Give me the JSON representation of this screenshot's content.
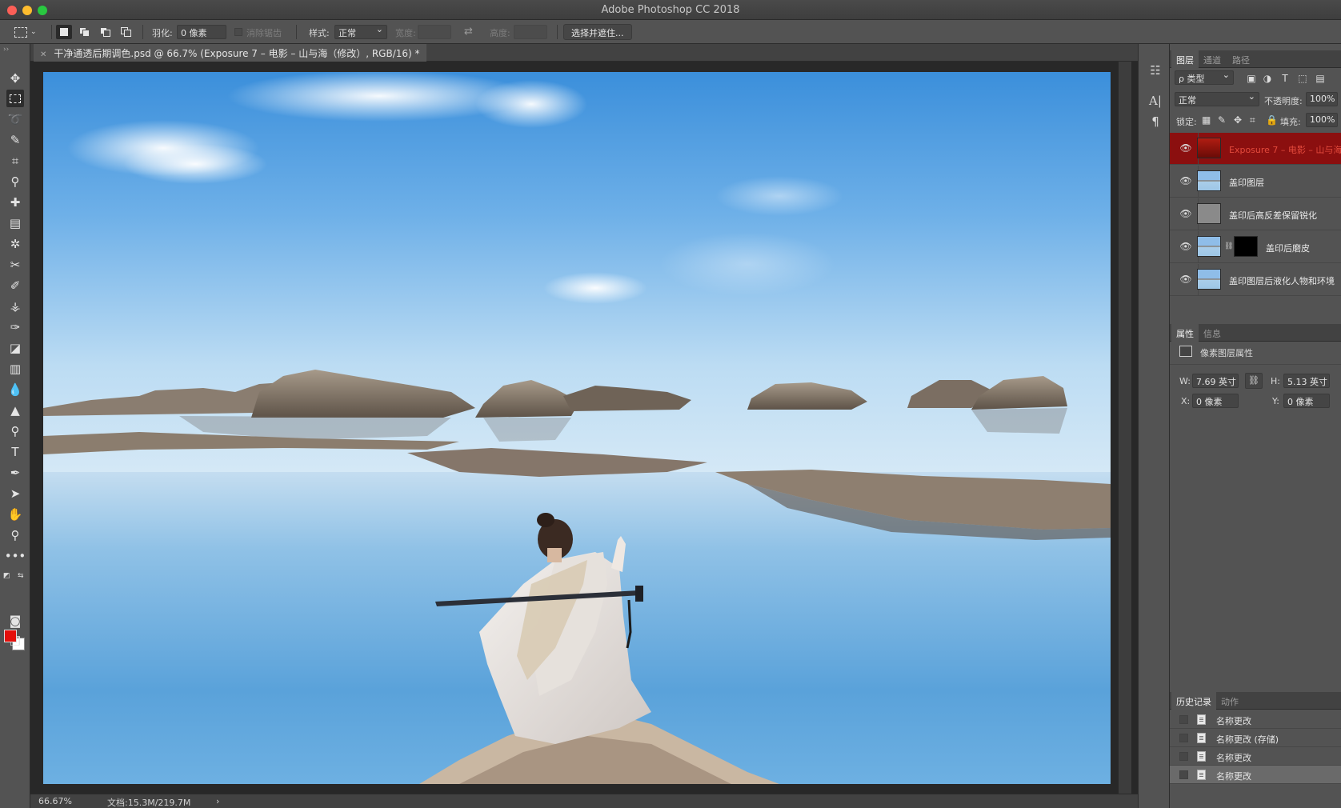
{
  "window": {
    "title": "Adobe Photoshop CC 2018"
  },
  "options_bar": {
    "feather_label": "羽化:",
    "feather_value": "0 像素",
    "antialias_label": "消除锯齿",
    "style_label": "样式:",
    "style_value": "正常",
    "width_label": "宽度:",
    "height_label": "高度:",
    "select_mask_button": "选择并遮住..."
  },
  "document": {
    "tab_title": "干净通透后期调色.psd @ 66.7% (Exposure 7 – 电影 – 山与海（修改）, RGB/16) *",
    "zoom": "66.67%",
    "doc_size": "文档:15.3M/219.7M"
  },
  "tools": {
    "foreground_color": "#e40f0b",
    "background_color": "#ffffff"
  },
  "layers_panel": {
    "tabs": [
      "图层",
      "通道",
      "路径"
    ],
    "filter_kind": "ρ 类型",
    "blend_mode": "正常",
    "opacity_label": "不透明度:",
    "opacity_value": "100%",
    "lock_label": "锁定:",
    "fill_label": "填充:",
    "fill_value": "100%",
    "layers": [
      {
        "name": "Exposure 7 – 电影 – 山与海",
        "selected": true
      },
      {
        "name": "盖印图层",
        "selected": false
      },
      {
        "name": "盖印后高反差保留锐化",
        "selected": false
      },
      {
        "name": "盖印后磨皮",
        "selected": false
      },
      {
        "name": "盖印图层后液化人物和环境",
        "selected": false
      }
    ]
  },
  "properties_panel": {
    "tabs": [
      "属性",
      "信息"
    ],
    "heading": "像素图层属性",
    "w_label": "W:",
    "w_value": "7.69 英寸",
    "h_label": "H:",
    "h_value": "5.13 英寸",
    "x_label": "X:",
    "x_value": "0 像素",
    "y_label": "Y:",
    "y_value": "0 像素"
  },
  "history_panel": {
    "tabs": [
      "历史记录",
      "动作"
    ],
    "items": [
      {
        "name": "名称更改",
        "current": false
      },
      {
        "name": "名称更改 (存储)",
        "current": false
      },
      {
        "name": "名称更改",
        "current": false
      },
      {
        "name": "名称更改",
        "current": true
      }
    ]
  }
}
